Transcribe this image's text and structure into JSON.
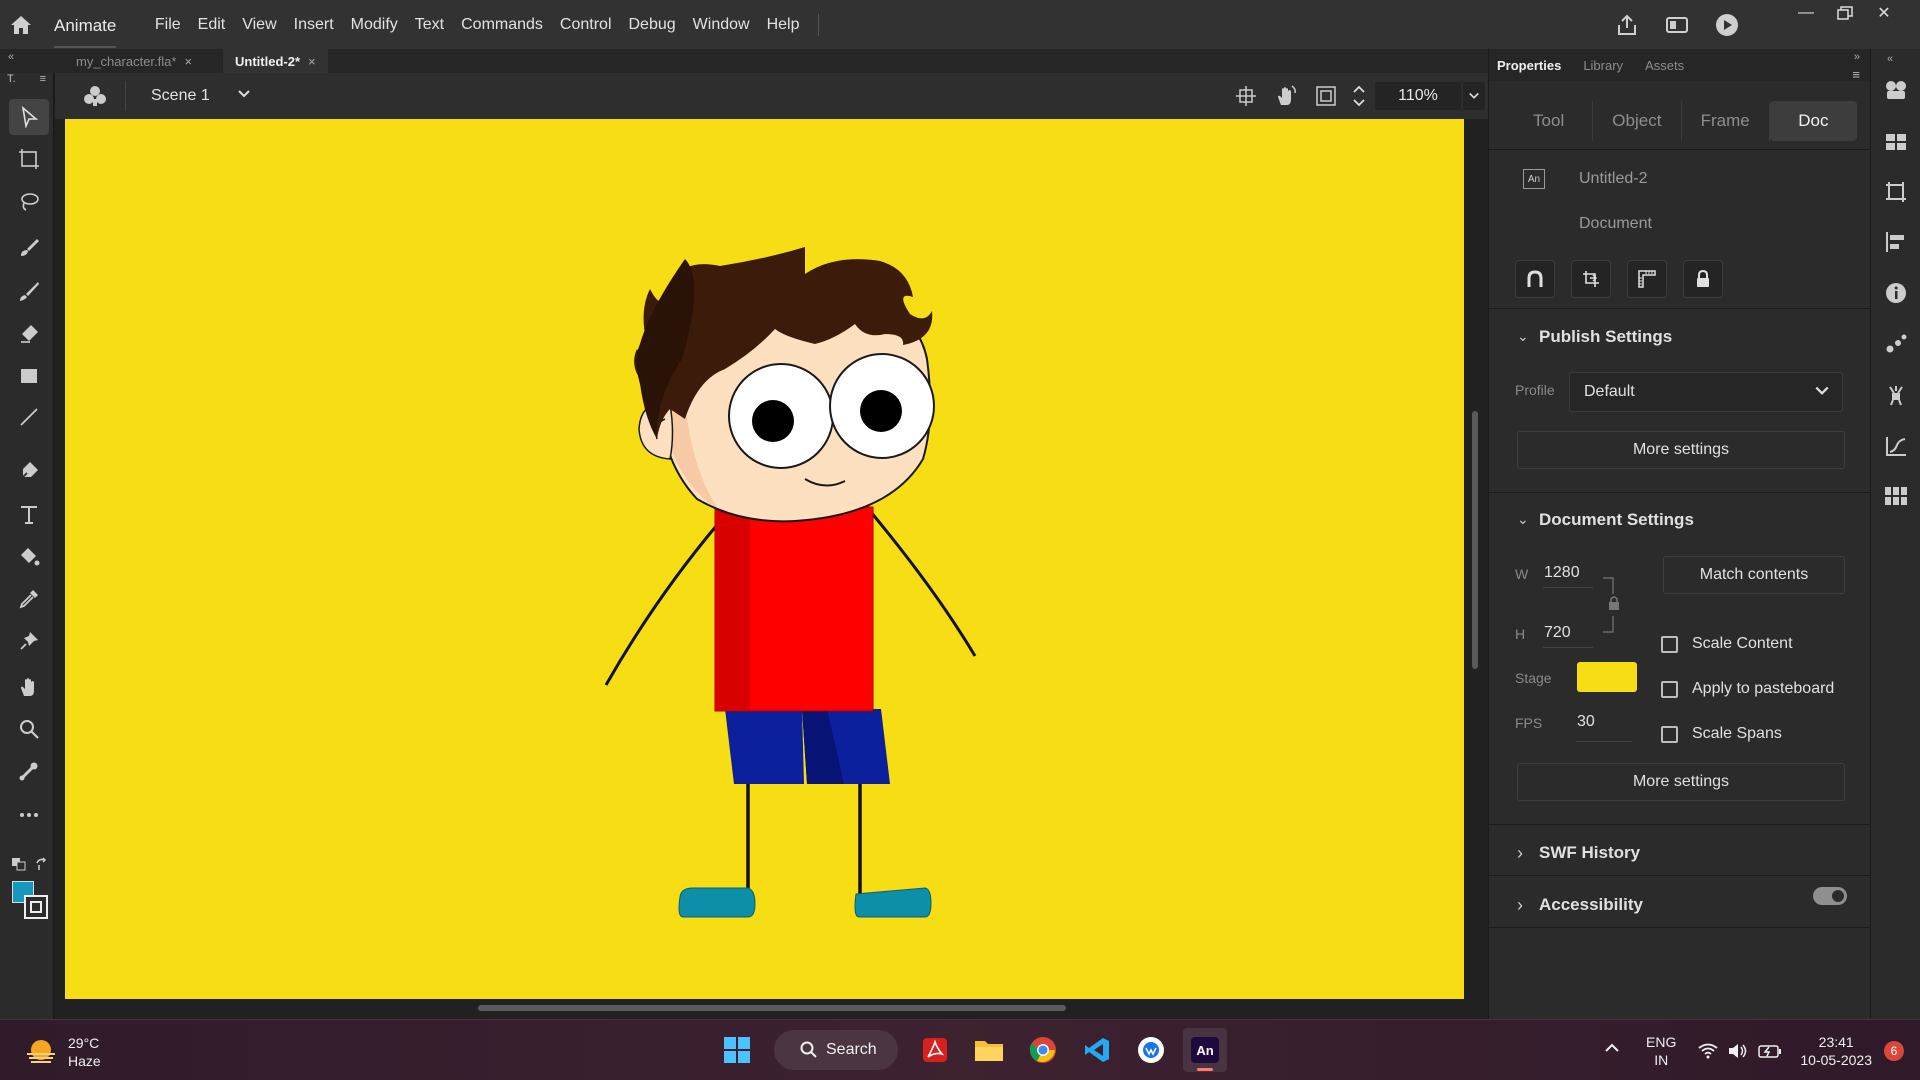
{
  "menubar": {
    "app_name": "Animate",
    "items": [
      "File",
      "Edit",
      "View",
      "Insert",
      "Modify",
      "Text",
      "Commands",
      "Control",
      "Debug",
      "Window",
      "Help"
    ]
  },
  "document_tabs": [
    {
      "label": "my_character.fla*",
      "active": false
    },
    {
      "label": "Untitled-2*",
      "active": true
    }
  ],
  "toolbar": {
    "header": "T."
  },
  "scene": {
    "label": "Scene 1",
    "zoom": "110%"
  },
  "stage": {
    "color": "#f7de14"
  },
  "panel": {
    "tabs": [
      "Properties",
      "Library",
      "Assets"
    ],
    "segments": [
      "Tool",
      "Object",
      "Frame",
      "Doc"
    ],
    "active_segment": "Doc",
    "doc_icon": "An",
    "doc_name": "Untitled-2",
    "doc_type": "Document",
    "publish": {
      "title": "Publish Settings",
      "profile_label": "Profile",
      "profile_value": "Default",
      "more_settings": "More settings"
    },
    "document_settings": {
      "title": "Document Settings",
      "w_label": "W",
      "w_value": "1280",
      "h_label": "H",
      "h_value": "720",
      "match_contents": "Match contents",
      "stage_label": "Stage",
      "stage_color": "#f7de14",
      "fps_label": "FPS",
      "fps_value": "30",
      "scale_content": "Scale Content",
      "apply_pasteboard": "Apply to pasteboard",
      "scale_spans": "Scale Spans",
      "more_settings": "More settings"
    },
    "swf_history": "SWF History",
    "accessibility": "Accessibility"
  },
  "taskbar": {
    "temperature": "29°C",
    "weather": "Haze",
    "search": "Search",
    "language_line1": "ENG",
    "language_line2": "IN",
    "time": "23:41",
    "date": "10-05-2023",
    "notification_count": "6"
  }
}
